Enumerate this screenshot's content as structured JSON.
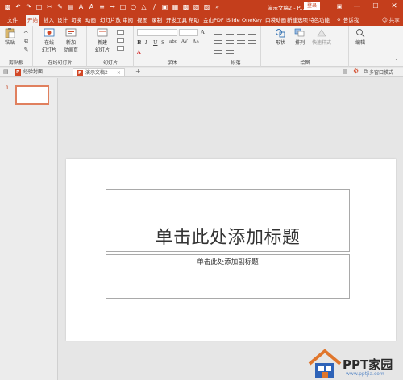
{
  "titlebar": {
    "doc_title": "演示文稿2 - P...",
    "login": "登录",
    "restore_icon": "ribbon-display-icon",
    "minimize": "—",
    "maximize": "☐",
    "close": "✕",
    "accent": "#c43e1c"
  },
  "tabs": [
    "文件",
    "开始",
    "插入",
    "设计",
    "切换",
    "动画",
    "幻灯片放",
    "审阅",
    "视图",
    "录制",
    "开发工具",
    "帮助",
    "金山PDF",
    "iSlide",
    "OneKey",
    "口袋动画",
    "新建选项",
    "特色功能"
  ],
  "active_tab": "开始",
  "help": {
    "label": "告诉我"
  },
  "share": {
    "label": "共享"
  },
  "ribbon": {
    "clipboard": {
      "paste": "粘贴",
      "label": "剪贴板"
    },
    "online_slides": {
      "button_line1": "在线",
      "button_line2": "幻灯片",
      "label": "在线幻灯片"
    },
    "new_animation": {
      "line1": "新加",
      "line2": "动画页"
    },
    "slides": {
      "new_line1": "新建",
      "new_line2": "幻灯片",
      "label": "幻灯片"
    },
    "font": {
      "label": "字体",
      "bold": "B",
      "italic": "I",
      "underline": "U",
      "strike": "S",
      "shadow": "abc",
      "spacing": "AV",
      "case": "Aa",
      "fontcolor": "A"
    },
    "paragraph": {
      "label": "段落"
    },
    "drawing": {
      "shape": "形状",
      "arrange": "排列",
      "quick_style": "快速样式",
      "label": "绘图"
    },
    "editing": {
      "label": "编辑"
    }
  },
  "doctabs": [
    {
      "label": "经验封面",
      "active": false
    },
    {
      "label": "演示文稿2",
      "active": true
    }
  ],
  "docbar_right": {
    "multi_window": "多窗口模式"
  },
  "thumbnails": {
    "number": "1"
  },
  "slide": {
    "title_placeholder": "单击此处添加标题",
    "subtitle_placeholder": "单击此处添加副标题"
  },
  "watermark": {
    "brand": "PPT家园",
    "url": "www.pptjia.com"
  }
}
